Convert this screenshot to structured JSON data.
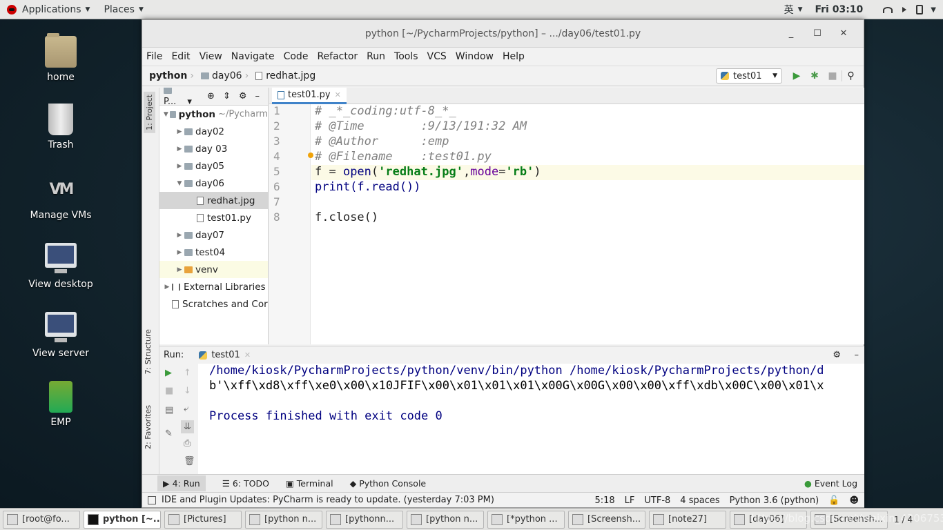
{
  "top_panel": {
    "applications": "Applications",
    "places": "Places",
    "ime": "英",
    "clock": "Fri 03:10"
  },
  "desktop_icons": [
    {
      "label": "home",
      "kind": "folder"
    },
    {
      "label": "Trash",
      "kind": "trash"
    },
    {
      "label": "Manage VMs",
      "kind": "vm"
    },
    {
      "label": "View desktop",
      "kind": "monitor"
    },
    {
      "label": "View server",
      "kind": "monitor"
    },
    {
      "label": "EMP",
      "kind": "emp"
    }
  ],
  "window": {
    "title": "python [~/PycharmProjects/python] – .../day06/test01.py"
  },
  "menu": [
    "File",
    "Edit",
    "View",
    "Navigate",
    "Code",
    "Refactor",
    "Run",
    "Tools",
    "VCS",
    "Window",
    "Help"
  ],
  "breadcrumb": [
    "python",
    "day06",
    "redhat.jpg"
  ],
  "run_config": "test01",
  "project_panel": {
    "title": "P...",
    "tabs": {
      "project": "1: Project",
      "structure": "7: Structure",
      "favorites": "2: Favorites"
    }
  },
  "tree": [
    {
      "label": "python",
      "note": "~/Pycharm",
      "depth": 0,
      "open": true,
      "bold": true
    },
    {
      "label": "day02",
      "depth": 1
    },
    {
      "label": "day 03",
      "depth": 1
    },
    {
      "label": "day05",
      "depth": 1
    },
    {
      "label": "day06",
      "depth": 1,
      "open": true
    },
    {
      "label": "redhat.jpg",
      "depth": 2,
      "file": true,
      "selected": true
    },
    {
      "label": "test01.py",
      "depth": 2,
      "file": true
    },
    {
      "label": "day07",
      "depth": 1
    },
    {
      "label": "test04",
      "depth": 1
    },
    {
      "label": "venv",
      "depth": 1,
      "venv": true
    },
    {
      "label": "External Libraries",
      "depth": 0
    },
    {
      "label": "Scratches and Cor",
      "depth": 0
    }
  ],
  "editor_tab": "test01.py",
  "code_lines": [
    "1",
    "2",
    "3",
    "4",
    "5",
    "6",
    "7",
    "8"
  ],
  "code": {
    "l1": "# _*_coding:utf-8_*_",
    "l2": "# @Time        :9/13/191:32 AM",
    "l3": "# @Author      :emp",
    "l4": "# @Filename    :test01.py",
    "l5a": "f = ",
    "l5b": "open",
    "l5c": "(",
    "l5d": "'redhat.jpg'",
    "l5e": ",",
    "l5f": "mode",
    "l5g": "=",
    "l5h": "'rb'",
    "l5i": ")",
    "l6": "print(f.read())",
    "l8": "f.close()"
  },
  "run_panel": {
    "label": "Run:",
    "tab": "test01"
  },
  "console": [
    "/home/kiosk/PycharmProjects/python/venv/bin/python /home/kiosk/PycharmProjects/python/d",
    "b'\\xff\\xd8\\xff\\xe0\\x00\\x10JFIF\\x00\\x01\\x01\\x01\\x00G\\x00G\\x00\\x00\\xff\\xdb\\x00C\\x00\\x01\\x",
    "Process finished with exit code 0"
  ],
  "bottom_tools": {
    "run": "4: Run",
    "todo": "6: TODO",
    "terminal": "Terminal",
    "console": "Python Console",
    "event_log": "Event Log"
  },
  "status": {
    "message": "IDE and Plugin Updates: PyCharm is ready to update. (yesterday 7:03 PM)",
    "pos": "5:18",
    "lf": "LF",
    "enc": "UTF-8",
    "indent": "4 spaces",
    "interp": "Python 3.6 (python)"
  },
  "taskbar": [
    "[root@fo...",
    "python [~...",
    "[Pictures]",
    "[python n...",
    "[pythonn...",
    "[python n...",
    "[*python ...",
    "[Screensh...",
    "[note27]",
    "[day06]",
    "[Screensh..."
  ],
  "pager": "1 / 4",
  "watermark": "https://blog.csdn.net/weixin_43067532"
}
